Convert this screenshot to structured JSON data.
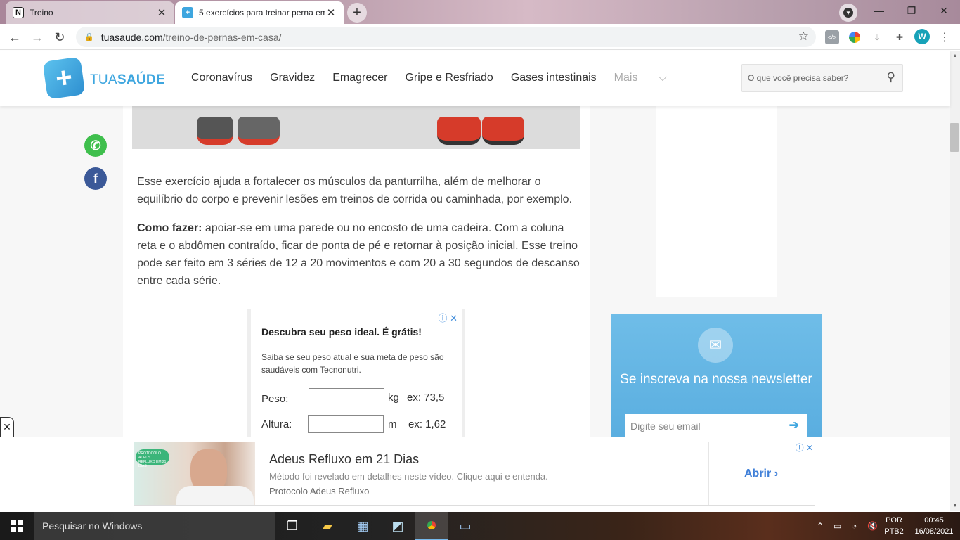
{
  "browser": {
    "tabs": [
      {
        "title": "Treino",
        "active": false,
        "favicon": "notion-icon"
      },
      {
        "title": "5 exercícios para treinar perna em",
        "active": true,
        "favicon": "tuasaude-icon"
      }
    ],
    "url_domain": "tuasaude.com",
    "url_path": "/treino-de-pernas-em-casa/",
    "profile_initial": "W"
  },
  "site": {
    "logo_text_light": "TUA",
    "logo_text_bold": "SAÚDE",
    "nav": [
      "Coronavírus",
      "Gravidez",
      "Emagrecer",
      "Gripe e Resfriado",
      "Gases intestinais",
      "Mais"
    ],
    "search_placeholder": "O que você precisa saber?"
  },
  "article": {
    "para1": "Esse exercício ajuda a fortalecer os músculos da panturrilha, além de melhorar o equilíbrio do corpo e prevenir lesões em treinos de corrida ou caminhada, por exemplo.",
    "howto_label": "Como fazer:",
    "howto_text": " apoiar-se em uma parede ou no encosto de uma cadeira. Com a coluna reta e o abdômen contraído, ficar de ponta de pé e retornar à posição inicial. Esse treino pode ser feito em 3 séries de 12 a 20 movimentos e com 20 a 30 segundos de descanso entre cada série."
  },
  "inline_ad": {
    "heading": "Descubra seu peso ideal. É grátis!",
    "sub": "Saiba se seu peso atual e sua meta de peso são saudáveis com Tecnonutri.",
    "weight_label": "Peso:",
    "weight_unit": "kg",
    "weight_example": "ex: 73,5",
    "height_label": "Altura:",
    "height_unit": "m",
    "height_example": "ex: 1,62"
  },
  "newsletter": {
    "title": "Se inscreva na nossa newsletter",
    "email_placeholder": "Digite seu email"
  },
  "bottom_ad": {
    "badge": "PROTOCOLO ADEUS REFLUXO EM 21 DIAS",
    "title": "Adeus Refluxo em 21 Dias",
    "description": "Método foi revelado em detalhes neste vídeo. Clique aqui e entenda.",
    "source": "Protocolo Adeus Refluxo",
    "cta": "Abrir"
  },
  "taskbar": {
    "search_placeholder": "Pesquisar no Windows",
    "lang_top": "POR",
    "lang_bottom": "PTB2",
    "time": "00:45",
    "date": "16/08/2021"
  },
  "colors": {
    "brand": "#3ea6df",
    "whatsapp": "#3fbf4d",
    "facebook": "#3b5998",
    "cta": "#3f7fd8"
  }
}
